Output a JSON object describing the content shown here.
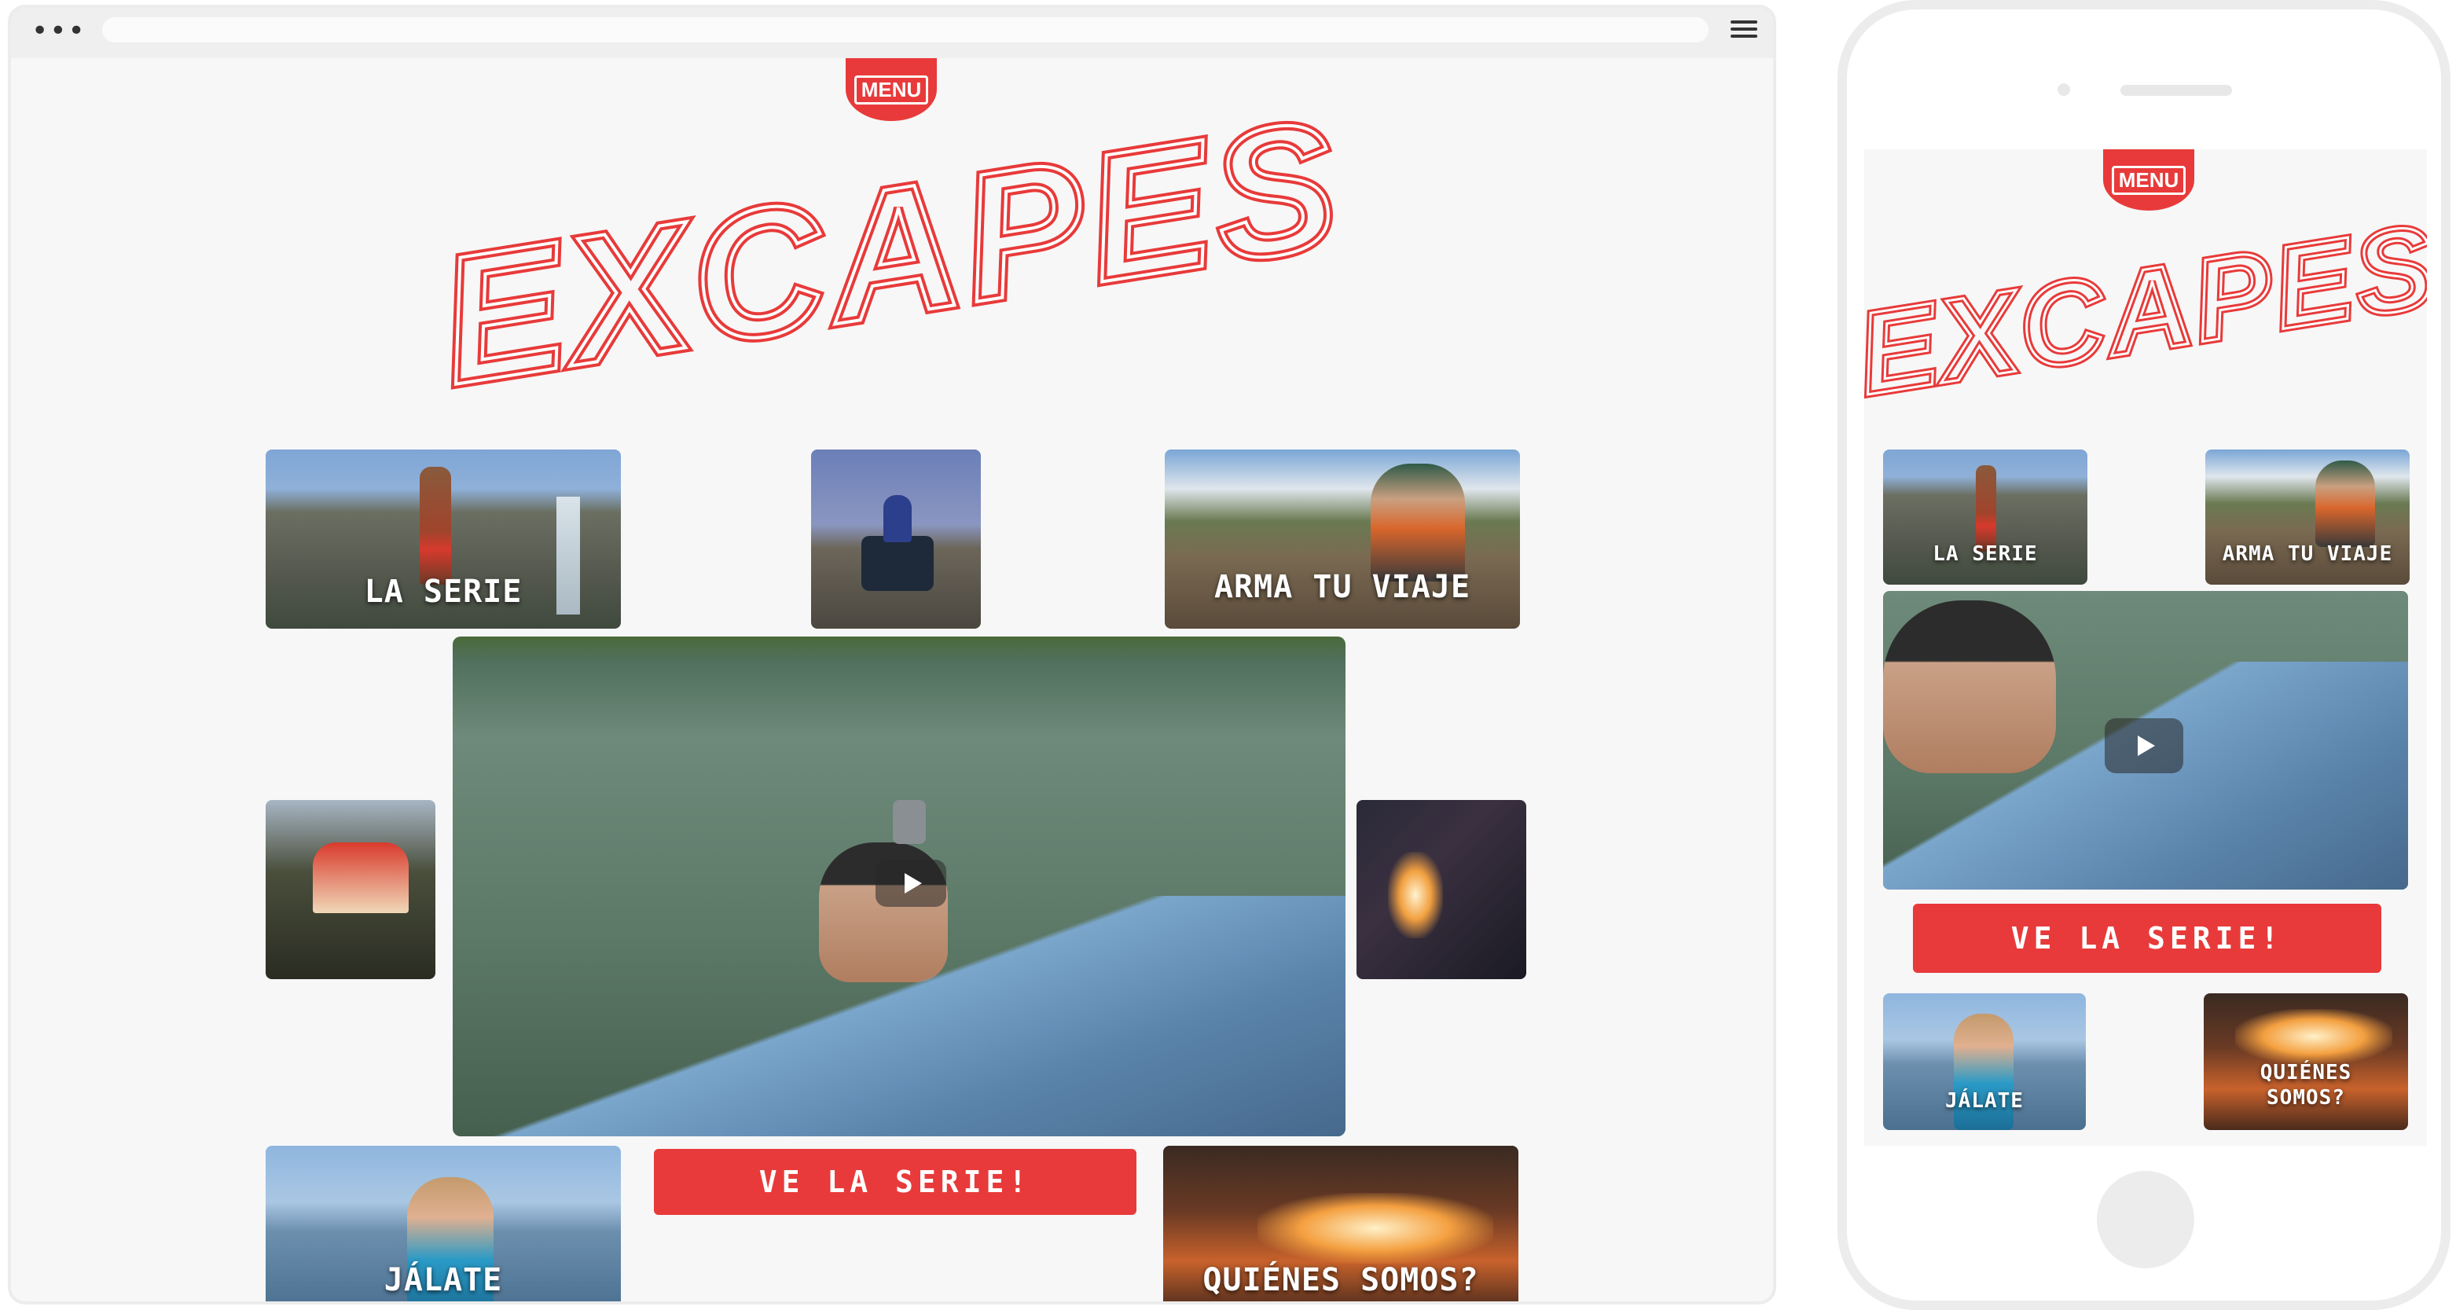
{
  "menu_label": "MENU",
  "brand": "EXCAPES",
  "tiles": {
    "la_serie": "LA SERIE",
    "arma_tu_viaje": "ARMA TU VIAJE",
    "jalate": "JÁLATE",
    "quienes_somos": "QUIÉNES SOMOS?"
  },
  "mobile_tiles": {
    "quienes_line1": "QUIÉNES",
    "quienes_line2": "SOMOS?"
  },
  "cta": "VE LA SERIE!",
  "colors": {
    "brand_red": "#e83a3a",
    "background": "#f7f7f7"
  },
  "icons": [
    "menu-dots-icon",
    "hamburger-icon",
    "play-icon"
  ]
}
